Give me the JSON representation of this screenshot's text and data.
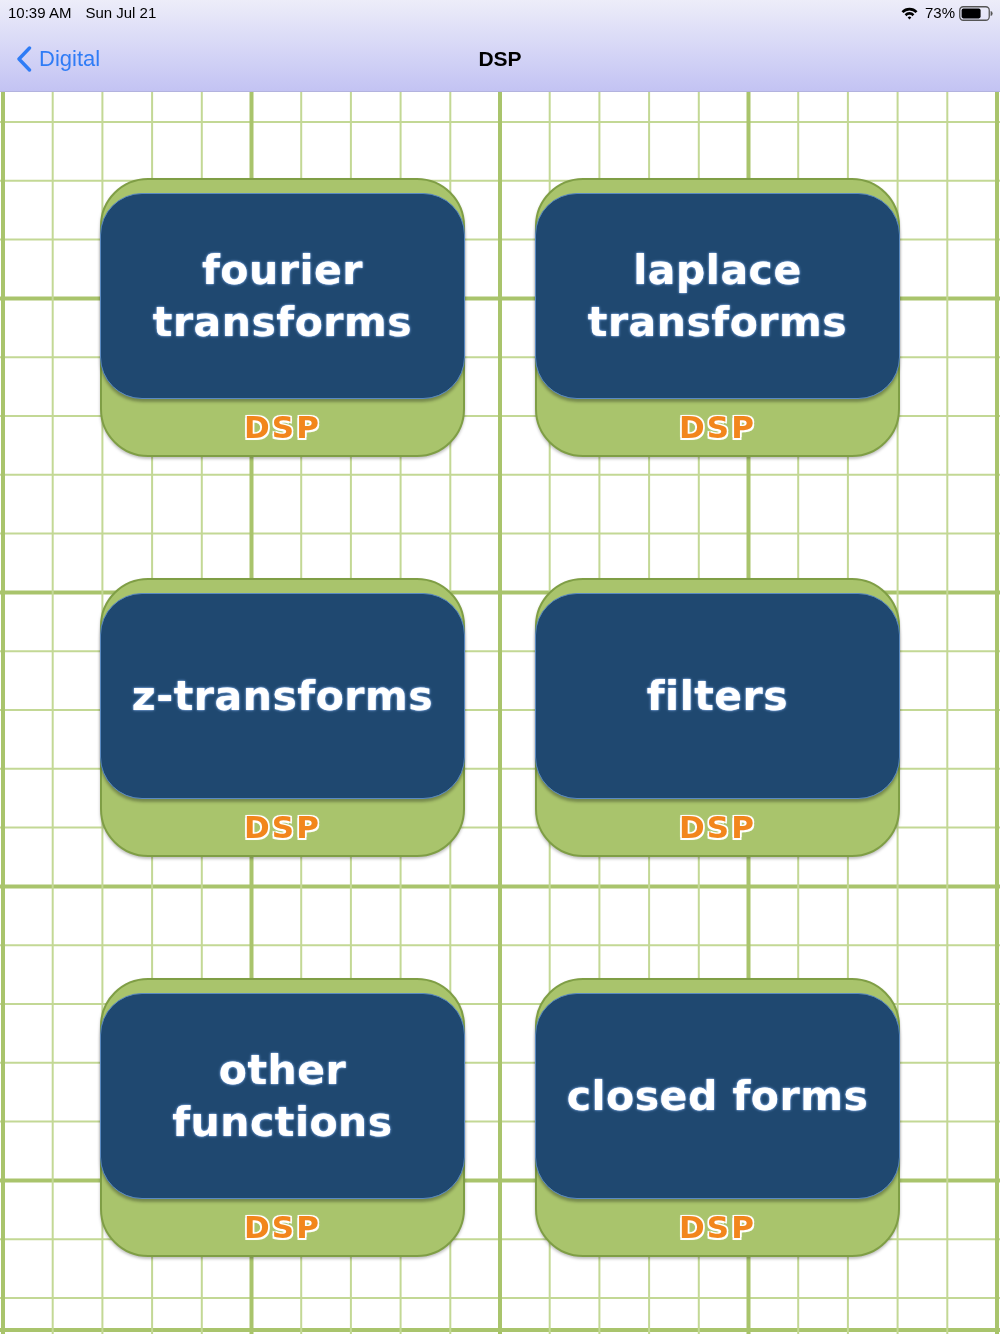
{
  "status_bar": {
    "time": "10:39 AM",
    "date": "Sun Jul 21",
    "battery": "73%"
  },
  "nav_bar": {
    "back_button": "Digital",
    "title": "DSP"
  },
  "tiles": [
    {
      "title": "fourier transforms",
      "label": "DSP"
    },
    {
      "title": "laplace transforms",
      "label": "DSP"
    },
    {
      "title": "z-transforms",
      "label": "DSP"
    },
    {
      "title": "filters",
      "label": "DSP"
    },
    {
      "title": "other functions",
      "label": "DSP"
    },
    {
      "title": "closed forms",
      "label": "DSP"
    }
  ]
}
